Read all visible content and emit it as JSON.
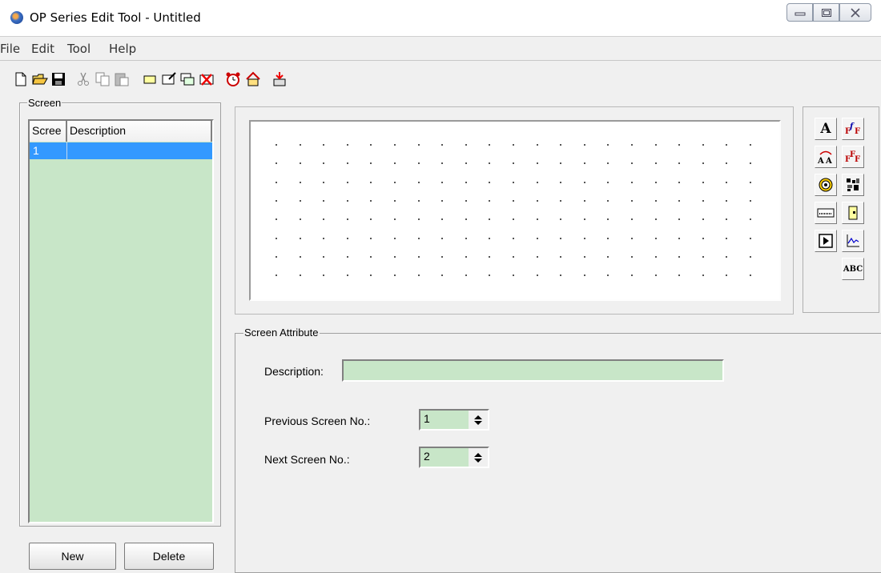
{
  "window": {
    "title": "OP Series Edit Tool - Untitled",
    "controls": [
      "minimize",
      "maximize",
      "close"
    ]
  },
  "menu": [
    "File",
    "Edit",
    "Tool",
    "Help"
  ],
  "toolbar": [
    "new-file-icon",
    "open-folder-icon",
    "save-icon",
    "cut-icon",
    "copy-icon",
    "paste-icon",
    "new-screen-icon",
    "edit-screen-icon",
    "copy-screen-icon",
    "delete-screen-icon",
    "alarm-clock-icon",
    "home-icon",
    "download-icon"
  ],
  "screen_panel": {
    "group_label": "Screen",
    "columns": [
      "Scree",
      "Description"
    ],
    "rows": [
      {
        "no": "1",
        "description": ""
      }
    ],
    "new_label": "New",
    "delete_label": "Delete"
  },
  "palette": {
    "text_a": "A",
    "abc": "ABC"
  },
  "attributes": {
    "group_label": "Screen Attribute",
    "description_label": "Description:",
    "description_value": "",
    "prev_label": "Previous Screen No.:",
    "prev_value": "1",
    "next_label": "Next Screen No.:",
    "next_value": "2"
  },
  "colors": {
    "list_bg": "#c8e6c8",
    "selection": "#3399ff"
  }
}
